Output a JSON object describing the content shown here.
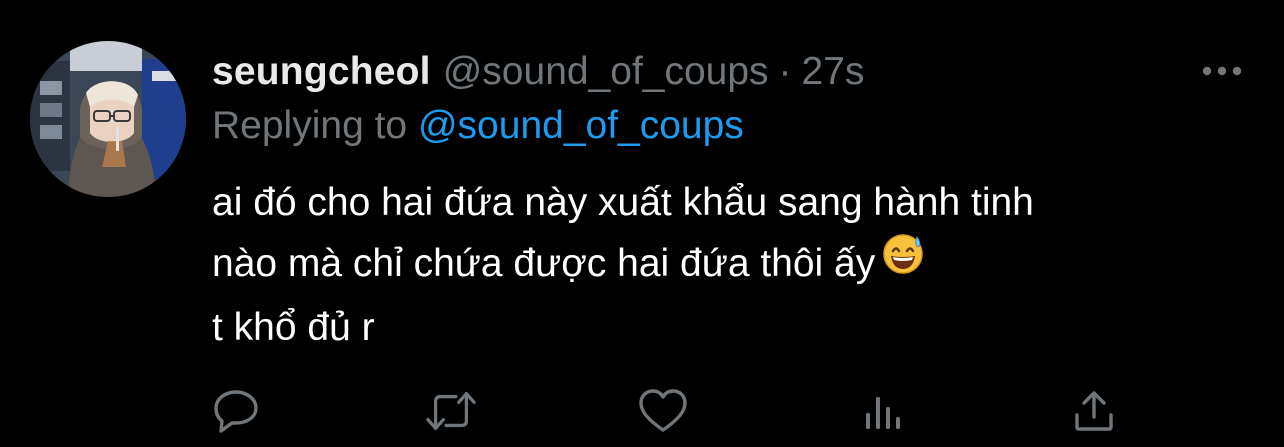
{
  "tweet": {
    "display_name": "seungcheol",
    "handle": "@sound_of_coups",
    "separator": "·",
    "timestamp": "27s",
    "reply_prefix": "Replying to",
    "reply_handle": "@sound_of_coups",
    "body_lines": [
      "ai đó cho hai đứa này xuất khẩu sang hành tinh",
      "nào mà chỉ chứa được hai đứa thôi ấy",
      "t khổ đủ r"
    ],
    "body_emoji": "grinning-face-with-sweat"
  },
  "icons": {
    "more": "more-horizontal-icon",
    "reply": "reply-icon",
    "retweet": "retweet-icon",
    "like": "heart-icon",
    "views": "analytics-icon",
    "share": "share-icon"
  },
  "colors": {
    "background": "#000000",
    "primary_text": "#e7e9ea",
    "secondary_text": "#71767b",
    "accent": "#1d9bf0"
  }
}
